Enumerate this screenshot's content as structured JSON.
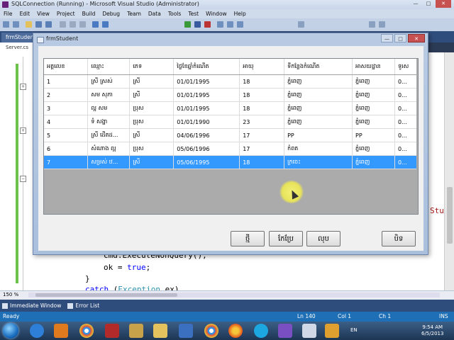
{
  "vs": {
    "title": "SQLConnection (Running) - Microsoft Visual Studio (Administrator)",
    "menu": [
      "File",
      "Edit",
      "View",
      "Project",
      "Build",
      "Debug",
      "Team",
      "Data",
      "Tools",
      "Test",
      "Window",
      "Help"
    ],
    "doc_tab": "frmStudent",
    "side_tab": "Server.cs",
    "zoom": "150 %",
    "code": {
      "line1": "cmd.ExecuteNonQuery();",
      "line2_a": "ok = ",
      "line2_kw": "true",
      "line2_b": ";",
      "line3": "}",
      "line4_kw": "catch",
      "line4_b": " (",
      "line4_ty": "Exception",
      "line4_c": " ex)",
      "right_fragment": "Stu"
    },
    "bottom_tabs": [
      "Immediate Window",
      "Error List"
    ],
    "status": {
      "ready": "Ready",
      "ln": "Ln 140",
      "col": "Col 1",
      "ch": "Ch 1",
      "ins": "INS"
    }
  },
  "taskbar": {
    "lang": "EN",
    "time": "9:54 AM",
    "date": "6/5/2013"
  },
  "form": {
    "title": "frmStudent",
    "columns": [
      "អត្តលេខ",
      "ឈ្មោះ",
      "ភេទ",
      "ថ្ងៃខែឆ្នាំកំណើត",
      "អាយុ",
      "ទីកន្លែងកំណើត",
      "អាសយដ្ឋាន",
      "ទូរស"
    ],
    "rows": [
      [
        "1",
        "ស្រី ស្រស់",
        "ស្រី",
        "01/01/1995",
        "18",
        "ភ្នំពេញ",
        "ភ្នំពេញ",
        "0..."
      ],
      [
        "2",
        "សម សុភា",
        "ស្រី",
        "01/01/1995",
        "18",
        "ភ្នំពេញ",
        "ភ្នំពេញ",
        "0..."
      ],
      [
        "3",
        "ល្អ សម",
        "ប្រុស",
        "01/01/1995",
        "18",
        "ភ្នំពេញ",
        "ភ្នំពេញ",
        "0..."
      ],
      [
        "4",
        "ទំ សង្ហា",
        "ប្រុស",
        "01/01/1990",
        "23",
        "ភ្នំពេញ",
        "ភ្នំពេញ",
        "0..."
      ],
      [
        "5",
        "ស្រី ដើតដ...",
        "ស្រី",
        "04/06/1996",
        "17",
        "PP",
        "PP",
        "0..."
      ],
      [
        "6",
        "សំណាង ល្អ",
        "ប្រុស",
        "05/06/1996",
        "17",
        "កំពត",
        "ភ្នំពេញ",
        "0..."
      ],
      [
        "7",
        "សម្រស់ ឋ...",
        "ស្រី",
        "05/06/1995",
        "18",
        "ក្រចេះ",
        "ភ្នំពេញ",
        "0..."
      ]
    ],
    "selected_row": 6,
    "buttons": {
      "new": "ថ្មី",
      "edit": "កែប្រែ",
      "delete": "លុប",
      "close": "បិទ"
    }
  },
  "colors": {
    "selection": "#3399ff",
    "vs_status": "#1e6fb5",
    "window_frame": "#b9cbe3"
  }
}
